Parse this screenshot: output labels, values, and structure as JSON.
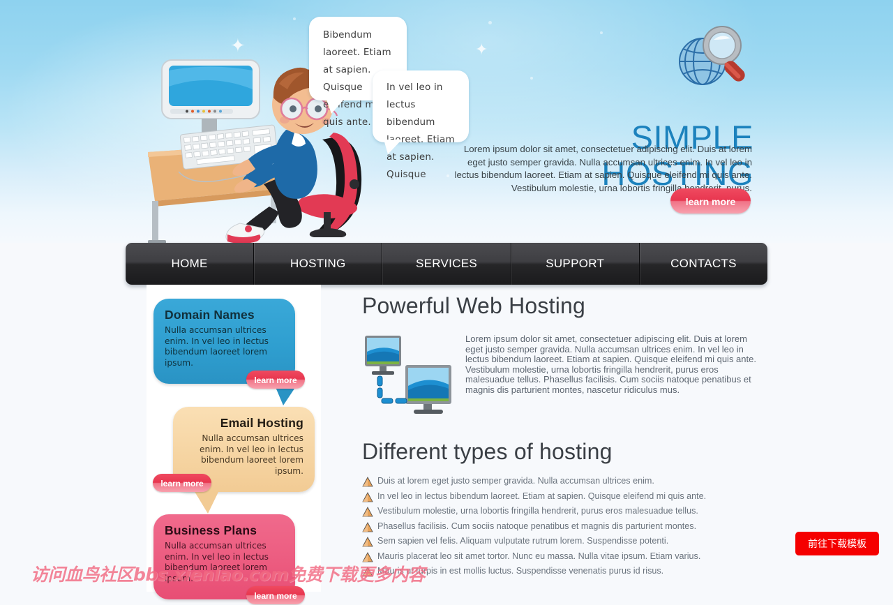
{
  "hero": {
    "title": "SIMPLE HOSTING",
    "description": "Lorem ipsum dolor sit amet, consectetuer adipiscing elit. Duis at lorem eget justo semper gravida. Nulla accumsan ultrices enim. In vel leo in lectus bibendum laoreet. Etiam at sapien. Quisque eleifend mi quis ante. Vestibulum molestie, urna lobortis fringilla hendrerit, purus.",
    "learn_more_label": "learn more",
    "bubble_1": "Bibendum laoreet. Etiam at sapien. Quisque eleifend mi quis ante.",
    "bubble_2": "In vel leo in lectus bibendum laoreet. Etiam at sapien. Quisque",
    "globe_icon": "globe-search-icon",
    "illustration": "boy-at-computer-illustration"
  },
  "nav": {
    "items": [
      {
        "label": "HOME"
      },
      {
        "label": "HOSTING"
      },
      {
        "label": "SERVICES"
      },
      {
        "label": "SUPPORT"
      },
      {
        "label": "CONTACTS"
      }
    ]
  },
  "sidebar": {
    "bubbles": [
      {
        "title": "Domain Names",
        "text": "Nulla accumsan ultrices enim. In vel leo in lectus bibendum laoreet lorem ipsum.",
        "learn_more_label": "learn more",
        "color": "#2f9fd0"
      },
      {
        "title": "Email Hosting",
        "text": "Nulla accumsan ultrices enim. In vel leo in lectus bibendum laoreet lorem ipsum.",
        "learn_more_label": "learn more",
        "color": "#f6d5a3"
      },
      {
        "title": "Business Plans",
        "text": "Nulla accumsan ultrices enim. In vel leo in lectus bibendum laoreet lorem ipsum.",
        "learn_more_label": "learn more",
        "color": "#ec5c80"
      }
    ]
  },
  "main": {
    "powerful_heading": "Powerful Web Hosting",
    "powerful_text": "Lorem ipsum dolor sit amet, consectetuer adipiscing elit. Duis at lorem eget justo semper gravida. Nulla accumsan ultrices enim. In vel leo in lectus bibendum laoreet. Etiam at sapien. Quisque eleifend mi quis ante. Vestibulum molestie, urna lobortis fringilla hendrerit, purus eros malesuadue tellus. Phasellus facilisis. Cum sociis natoque penatibus et magnis dis parturient montes, nascetur ridiculus mus.",
    "monitors_icon": "two-monitors-network-icon",
    "types_heading": "Different types of hosting",
    "types_items": [
      "Duis at lorem eget justo semper gravida. Nulla accumsan ultrices enim.",
      "In vel leo in lectus bibendum laoreet. Etiam at sapien. Quisque eleifend mi quis ante.",
      "Vestibulum molestie, urna lobortis fringilla hendrerit, purus eros malesuadue tellus.",
      "Phasellus facilisis. Cum sociis natoque penatibus et magnis dis parturient montes.",
      "Sem sapien vel felis. Aliquam vulputate rutrum lorem. Suspendisse potenti.",
      "Mauris placerat leo sit amet tortor. Nunc eu massa. Nulla vitae ipsum. Etiam varius.",
      "Mauris ut turpis in est mollis luctus. Suspendisse venenatis purus id risus."
    ]
  },
  "overlay": {
    "watermark": "访问血鸟社区bbs.xienlao.com免费下载更多内容",
    "download_button": "前往下载模板"
  },
  "colors": {
    "hero_title": "#1c82bd",
    "accent_red": "#e8364f",
    "nav_dark": "#262628",
    "download_red": "#f50000",
    "watermark_pink": "#f26b83"
  }
}
